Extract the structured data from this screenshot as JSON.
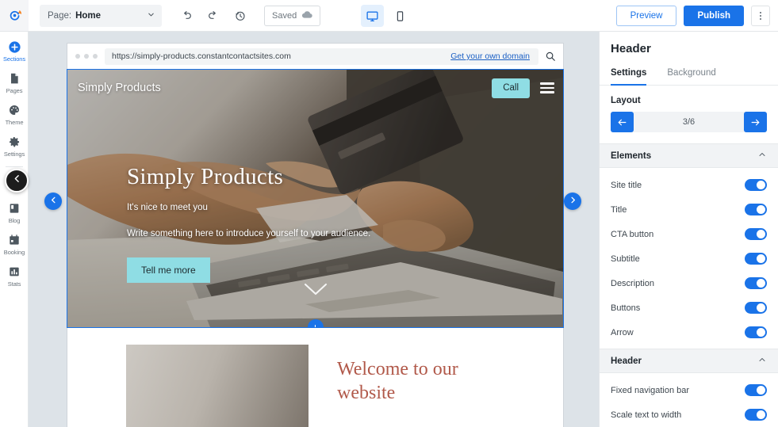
{
  "topbar": {
    "logo_icon": "constant-contact-logo",
    "page_label": "Page:",
    "page_value": "Home",
    "chevron_icon": "chevron-down-icon",
    "undo_icon": "undo-icon",
    "redo_icon": "redo-icon",
    "history_icon": "history-icon",
    "saved_label": "Saved",
    "saved_icon": "cloud-icon",
    "desktop_icon": "desktop-icon",
    "mobile_icon": "mobile-icon",
    "preview_label": "Preview",
    "publish_label": "Publish",
    "kebab_icon": "more-vertical-icon"
  },
  "sidebar": {
    "items": [
      {
        "label": "Sections",
        "icon": "plus-circle-icon",
        "active": true
      },
      {
        "label": "Pages",
        "icon": "page-icon",
        "active": false
      },
      {
        "label": "Theme",
        "icon": "palette-icon",
        "active": false
      },
      {
        "label": "Settings",
        "icon": "gear-icon",
        "active": false
      }
    ],
    "items2": [
      {
        "label": "",
        "icon": "shopping-cart-icon",
        "active": false
      },
      {
        "label": "Blog",
        "icon": "blog-icon",
        "active": false
      },
      {
        "label": "Booking",
        "icon": "calendar-icon",
        "active": false
      },
      {
        "label": "Stats",
        "icon": "bar-chart-icon",
        "active": false
      }
    ],
    "collapse_icon": "chevron-left-icon"
  },
  "canvas": {
    "prev_section_icon": "chevron-left-icon",
    "next_section_icon": "chevron-right-icon",
    "browser": {
      "url": "https://simply-products.constantcontactsites.com",
      "get_domain_label": "Get your own domain",
      "search_icon": "search-icon"
    },
    "hero": {
      "site_title": "Simply Products",
      "call_label": "Call",
      "menu_icon": "hamburger-menu-icon",
      "heading": "Simply Products",
      "subtitle": "It's nice to meet you",
      "description": "Write something here to introduce yourself to your audience.",
      "cta_label": "Tell me more",
      "arrow_icon": "chevron-down-icon",
      "add_section_icon": "plus-icon",
      "accent_color": "#8fdde4"
    },
    "welcome": {
      "heading": "Welcome to our website",
      "image_alt": "welcome-image-placeholder",
      "heading_color": "#b1594a"
    }
  },
  "panel": {
    "title": "Header",
    "tabs": [
      {
        "label": "Settings",
        "active": true
      },
      {
        "label": "Background",
        "active": false
      }
    ],
    "layout": {
      "label": "Layout",
      "prev_icon": "arrow-left-icon",
      "next_icon": "arrow-right-icon",
      "value": "3/6"
    },
    "elements": {
      "label": "Elements",
      "chevron_icon": "chevron-up-icon",
      "rows": [
        {
          "label": "Site title",
          "on": true
        },
        {
          "label": "Title",
          "on": true
        },
        {
          "label": "CTA button",
          "on": true
        },
        {
          "label": "Subtitle",
          "on": true
        },
        {
          "label": "Description",
          "on": true
        },
        {
          "label": "Buttons",
          "on": true
        },
        {
          "label": "Arrow",
          "on": true
        }
      ]
    },
    "header": {
      "label": "Header",
      "chevron_icon": "chevron-up-icon",
      "rows": [
        {
          "label": "Fixed navigation bar",
          "on": true
        },
        {
          "label": "Scale text to width",
          "on": true
        }
      ]
    },
    "accent_color": "#1a73e8"
  }
}
